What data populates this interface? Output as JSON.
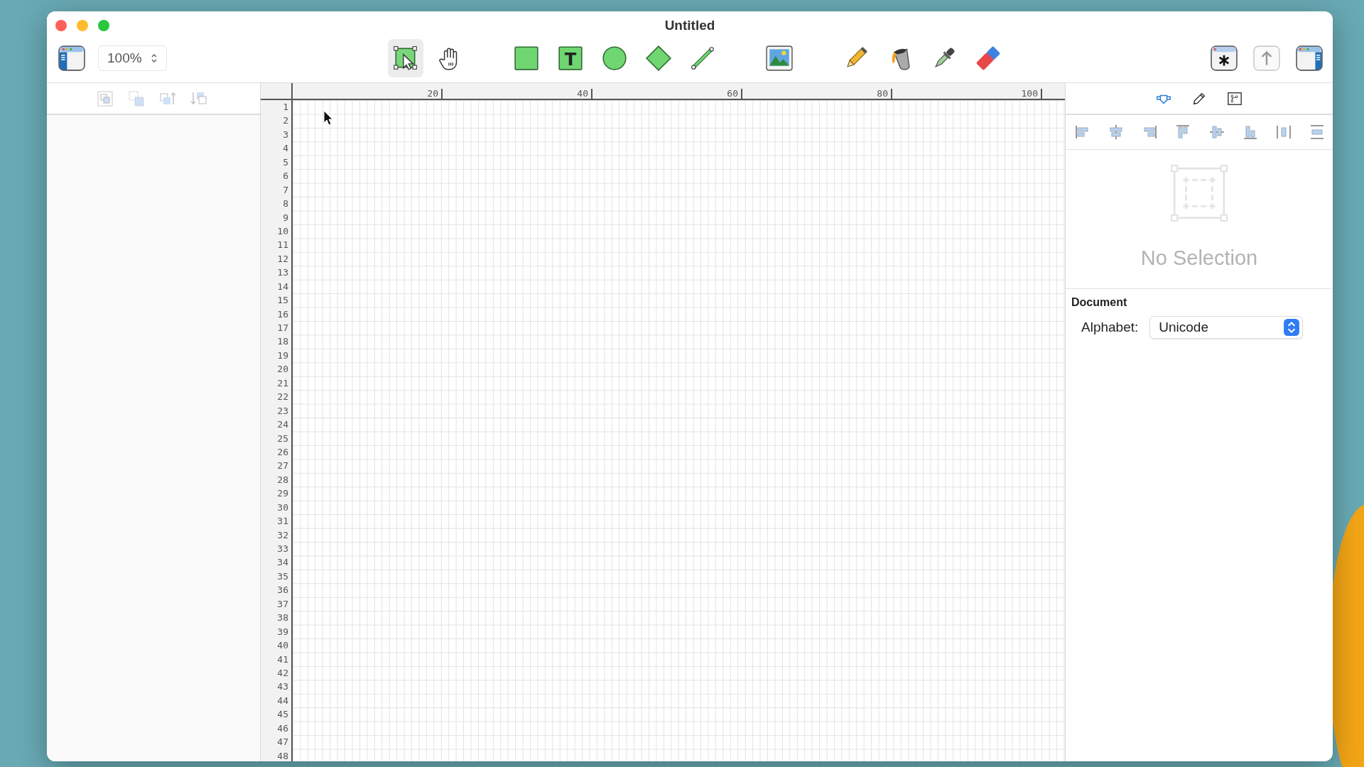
{
  "window": {
    "title": "Untitled"
  },
  "toolbar": {
    "zoom": "100%",
    "tool_groups": [
      [
        {
          "kind": "select",
          "selected": true
        },
        {
          "kind": "hand",
          "selected": false
        }
      ],
      [
        {
          "kind": "rect",
          "selected": false
        },
        {
          "kind": "text",
          "glyph": "T",
          "selected": false
        },
        {
          "kind": "circle",
          "selected": false
        },
        {
          "kind": "diamond",
          "selected": false
        },
        {
          "kind": "line",
          "selected": false
        }
      ],
      [
        {
          "kind": "image",
          "selected": false
        }
      ],
      [
        {
          "kind": "pencil",
          "selected": false
        },
        {
          "kind": "bucket",
          "selected": false
        },
        {
          "kind": "dropper",
          "selected": false
        },
        {
          "kind": "eraser",
          "selected": false
        }
      ]
    ],
    "right_buttons": [
      {
        "kind": "special"
      },
      {
        "kind": "share"
      },
      {
        "kind": "inspector"
      }
    ]
  },
  "sidebar": {
    "buttons": [
      {
        "kind": "group",
        "disabled": true
      },
      {
        "kind": "ungroup",
        "disabled": true
      },
      {
        "kind": "forward",
        "disabled": true
      },
      {
        "kind": "backward",
        "disabled": true
      }
    ]
  },
  "ruler": {
    "columns": [
      "20",
      "40",
      "60",
      "80",
      "100"
    ],
    "rows": [
      "1",
      "2",
      "3",
      "4",
      "5",
      "6",
      "7",
      "8",
      "9",
      "10",
      "11",
      "12",
      "13",
      "14",
      "15",
      "16",
      "17",
      "18",
      "19",
      "20",
      "21",
      "22",
      "23",
      "24",
      "25",
      "26",
      "27",
      "28",
      "29",
      "30",
      "31",
      "32",
      "33",
      "34",
      "35",
      "36",
      "37",
      "38",
      "39",
      "40",
      "41",
      "42",
      "43",
      "44",
      "45",
      "46",
      "47",
      "48"
    ]
  },
  "inspector": {
    "tabs": [
      {
        "kind": "shape",
        "selected": true
      },
      {
        "kind": "pencil",
        "selected": false
      },
      {
        "kind": "diagram",
        "selected": false
      }
    ],
    "align_buttons": [
      {
        "kind": "left"
      },
      {
        "kind": "hcenter"
      },
      {
        "kind": "right"
      },
      {
        "kind": "top"
      },
      {
        "kind": "vcenter"
      },
      {
        "kind": "bottom"
      },
      {
        "kind": "hdist"
      },
      {
        "kind": "vdist"
      }
    ],
    "empty_state": "No Selection",
    "section": "Document",
    "fields": [
      {
        "label": "Alphabet:",
        "value": "Unicode"
      }
    ]
  }
}
